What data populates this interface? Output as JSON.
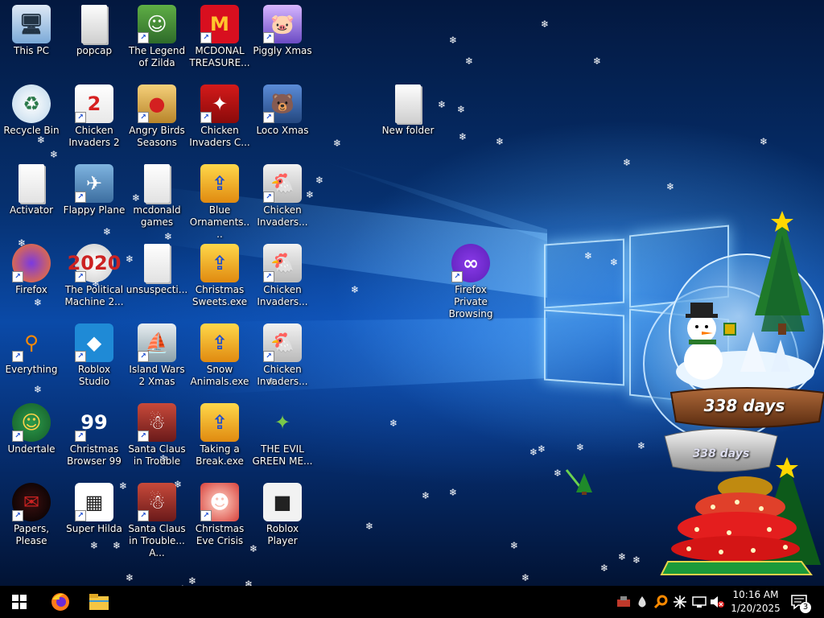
{
  "desktop": {
    "icons": [
      {
        "label": "This PC",
        "icon": "this-pc-icon",
        "shortcut": false
      },
      {
        "label": "popcap",
        "icon": "folder-icon",
        "shortcut": false
      },
      {
        "label": "The Legend of Zilda",
        "icon": "game-zilda-icon",
        "shortcut": true
      },
      {
        "label": "MCDONAL TREASURE...",
        "icon": "mcdonalds-icon",
        "shortcut": true
      },
      {
        "label": "Piggly Xmas",
        "icon": "piggly-xmas-icon",
        "shortcut": true
      },
      {
        "label": "Recycle Bin",
        "icon": "recycle-bin-icon",
        "shortcut": false
      },
      {
        "label": "Chicken Invaders 2",
        "icon": "chicken-invaders-2-icon",
        "shortcut": true
      },
      {
        "label": "Angry Birds Seasons",
        "icon": "angry-birds-icon",
        "shortcut": true
      },
      {
        "label": "Chicken Invaders C...",
        "icon": "chicken-invaders-c-icon",
        "shortcut": true
      },
      {
        "label": "Loco Xmas",
        "icon": "loco-xmas-icon",
        "shortcut": true
      },
      {
        "label": "New folder",
        "icon": "folder-icon",
        "shortcut": false
      },
      {
        "label": "Activator",
        "icon": "file-icon",
        "shortcut": false
      },
      {
        "label": "Flappy Plane",
        "icon": "flappy-plane-icon",
        "shortcut": true
      },
      {
        "label": "mcdonald games",
        "icon": "file-icon",
        "shortcut": false
      },
      {
        "label": "Blue Ornaments....",
        "icon": "setup-icon",
        "shortcut": false
      },
      {
        "label": "Chicken Invaders...",
        "icon": "chicken-invaders-icon",
        "shortcut": true
      },
      {
        "label": "Firefox",
        "icon": "firefox-icon",
        "shortcut": true
      },
      {
        "label": "The Political Machine 2...",
        "icon": "political-machine-icon",
        "shortcut": true
      },
      {
        "label": "unsuspecti...",
        "icon": "file-icon",
        "shortcut": false
      },
      {
        "label": "Christmas Sweets.exe",
        "icon": "setup-icon",
        "shortcut": false
      },
      {
        "label": "Chicken Invaders...",
        "icon": "chicken-invaders-icon",
        "shortcut": true
      },
      {
        "label": "Firefox Private Browsing",
        "icon": "firefox-private-icon",
        "shortcut": true
      },
      {
        "label": "Everything",
        "icon": "search-everything-icon",
        "shortcut": true
      },
      {
        "label": "Roblox Studio",
        "icon": "roblox-studio-icon",
        "shortcut": true
      },
      {
        "label": "Island Wars 2 Xmas",
        "icon": "island-wars-icon",
        "shortcut": true
      },
      {
        "label": "Snow Animals.exe",
        "icon": "setup-icon",
        "shortcut": false
      },
      {
        "label": "Chicken Invaders...",
        "icon": "chicken-invaders-icon",
        "shortcut": true
      },
      {
        "label": "Undertale",
        "icon": "undertale-icon",
        "shortcut": true
      },
      {
        "label": "Christmas Browser 99",
        "icon": "christmas-browser-icon",
        "shortcut": true
      },
      {
        "label": "Santa Claus in Trouble",
        "icon": "santa-trouble-icon",
        "shortcut": true
      },
      {
        "label": "Taking a Break.exe",
        "icon": "setup-icon",
        "shortcut": false
      },
      {
        "label": "THE EVIL GREEN ME...",
        "icon": "msn-icon",
        "shortcut": false
      },
      {
        "label": "Papers, Please",
        "icon": "papers-please-icon",
        "shortcut": true
      },
      {
        "label": "Super Hilda",
        "icon": "super-hilda-icon",
        "shortcut": true
      },
      {
        "label": "Santa Claus in Trouble... A...",
        "icon": "santa-trouble-icon",
        "shortcut": true
      },
      {
        "label": "Christmas Eve Crisis",
        "icon": "santa-face-icon",
        "shortcut": true
      },
      {
        "label": "Roblox Player",
        "icon": "roblox-player-icon",
        "shortcut": false
      }
    ]
  },
  "widget": {
    "countdown_main": "338 days",
    "countdown_base": "338 days"
  },
  "taskbar": {
    "start": "windows-start-icon",
    "pinned": [
      "firefox-icon",
      "file-explorer-icon"
    ],
    "tray": [
      "app-tray-icon",
      "droplet-icon",
      "search-tray-icon",
      "snowflake-icon",
      "network-icon",
      "volume-muted-icon"
    ],
    "time": "10:16 AM",
    "date": "1/20/2025",
    "notification_count": "3"
  },
  "colors": {
    "taskbar": "#000000",
    "wallpaper_dark": "#03183f",
    "wallpaper_light": "#0a4aa8"
  }
}
